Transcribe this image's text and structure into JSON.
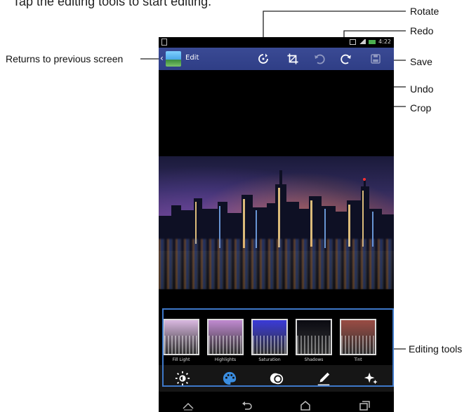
{
  "heading": "Tap the editing tools to start editing.",
  "status_bar": {
    "time": "4:22"
  },
  "action_bar": {
    "title": "Edit"
  },
  "callouts": {
    "back": "Returns to previous screen",
    "rotate": "Rotate",
    "redo": "Redo",
    "save": "Save",
    "undo": "Undo",
    "crop": "Crop",
    "editing_tools": "Editing tools"
  },
  "filters": [
    {
      "label": "Fill Light",
      "tint": "#d9b8e0"
    },
    {
      "label": "Highlights",
      "tint": "#c08ad0"
    },
    {
      "label": "Saturation",
      "tint": "#3a3ad8"
    },
    {
      "label": "Shadows",
      "tint": "#0b0b12"
    },
    {
      "label": "Tint",
      "tint": "#9a4c44"
    }
  ],
  "tools": [
    "brightness-icon",
    "palette-icon",
    "circles-icon",
    "pen-icon",
    "sparkle-icon"
  ],
  "colors": {
    "accent": "#3e78c9",
    "action_bar": "#33428c",
    "active_tool": "#3a8de0"
  }
}
